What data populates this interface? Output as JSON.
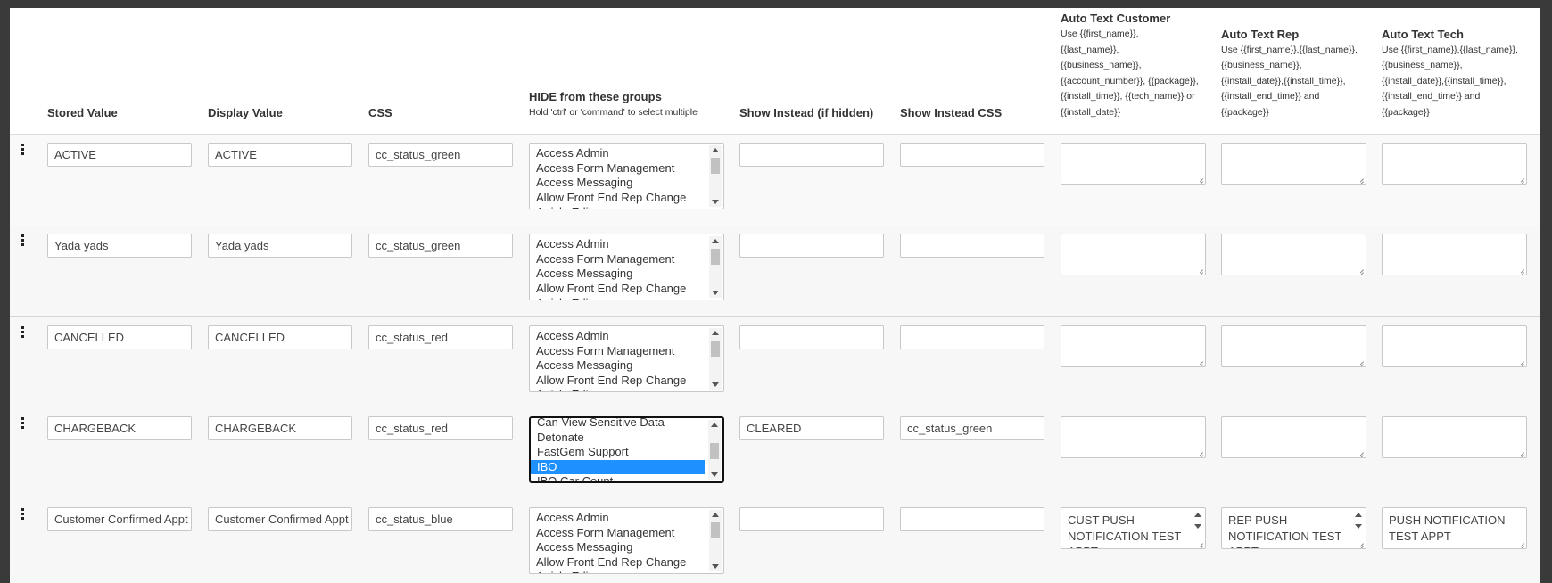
{
  "headers": {
    "stored_value": "Stored Value",
    "display_value": "Display Value",
    "css": "CSS",
    "hide_groups": "HIDE from these groups",
    "hide_groups_hint": "Hold 'ctrl' or 'command' to select multiple",
    "show_instead": "Show Instead (if hidden)",
    "show_instead_css": "Show Instead CSS",
    "auto_text_customer": "Auto Text Customer",
    "auto_text_customer_hint": [
      "Use {{first_name}},",
      "{{last_name}},",
      "{{business_name}},",
      "{{account_number}}, {{package}},",
      "{{install_time}}, {{tech_name}} or",
      "{{install_date}}"
    ],
    "auto_text_rep": "Auto Text Rep",
    "auto_text_rep_hint": [
      "Use {{first_name}},{{last_name}},",
      "{{business_name}},",
      "{{install_date}},{{install_time}},",
      "{{install_end_time}} and",
      "{{package}}"
    ],
    "auto_text_tech": "Auto Text Tech",
    "auto_text_tech_hint": [
      "Use {{first_name}},{{last_name}},",
      "{{business_name}},",
      "{{install_date}},{{install_time}},",
      "{{install_end_time}} and",
      "{{package}}"
    ]
  },
  "group_options_top": [
    "Access Admin",
    "Access Form Management",
    "Access Messaging",
    "Allow Front End Rep Change",
    "Article Editor"
  ],
  "group_options_scrolled": [
    "Can View Sensitive Data",
    "Detonate",
    "FastGem Support",
    "IBO",
    "IBO Car Count"
  ],
  "rows": [
    {
      "stored": "ACTIVE",
      "display": "ACTIVE",
      "css": "cc_status_green",
      "show_instead": "",
      "show_instead_css": "",
      "auto_customer": "",
      "auto_rep": "",
      "auto_tech": ""
    },
    {
      "stored": "Yada yads",
      "display": "Yada yads",
      "css": "cc_status_green",
      "show_instead": "",
      "show_instead_css": "",
      "auto_customer": "",
      "auto_rep": "",
      "auto_tech": ""
    },
    {
      "stored": "CANCELLED",
      "display": "CANCELLED",
      "css": "cc_status_red",
      "show_instead": "",
      "show_instead_css": "",
      "auto_customer": "",
      "auto_rep": "",
      "auto_tech": ""
    },
    {
      "stored": "CHARGEBACK",
      "display": "CHARGEBACK",
      "css": "cc_status_red",
      "show_instead": "CLEARED",
      "show_instead_css": "cc_status_green",
      "auto_customer": "",
      "auto_rep": "",
      "auto_tech": ""
    },
    {
      "stored": "Customer Confirmed Appt",
      "display": "Customer Confirmed Appt",
      "css": "cc_status_blue",
      "show_instead": "",
      "show_instead_css": "",
      "auto_customer": "CUST PUSH NOTIFICATION TEST APPT",
      "auto_rep": "REP PUSH NOTIFICATION TEST APPT",
      "auto_tech": "PUSH NOTIFICATION TEST  APPT"
    }
  ],
  "selected_group": "IBO",
  "colors": {
    "selection": "#1e90ff",
    "backdrop": "#3a3a3a"
  }
}
